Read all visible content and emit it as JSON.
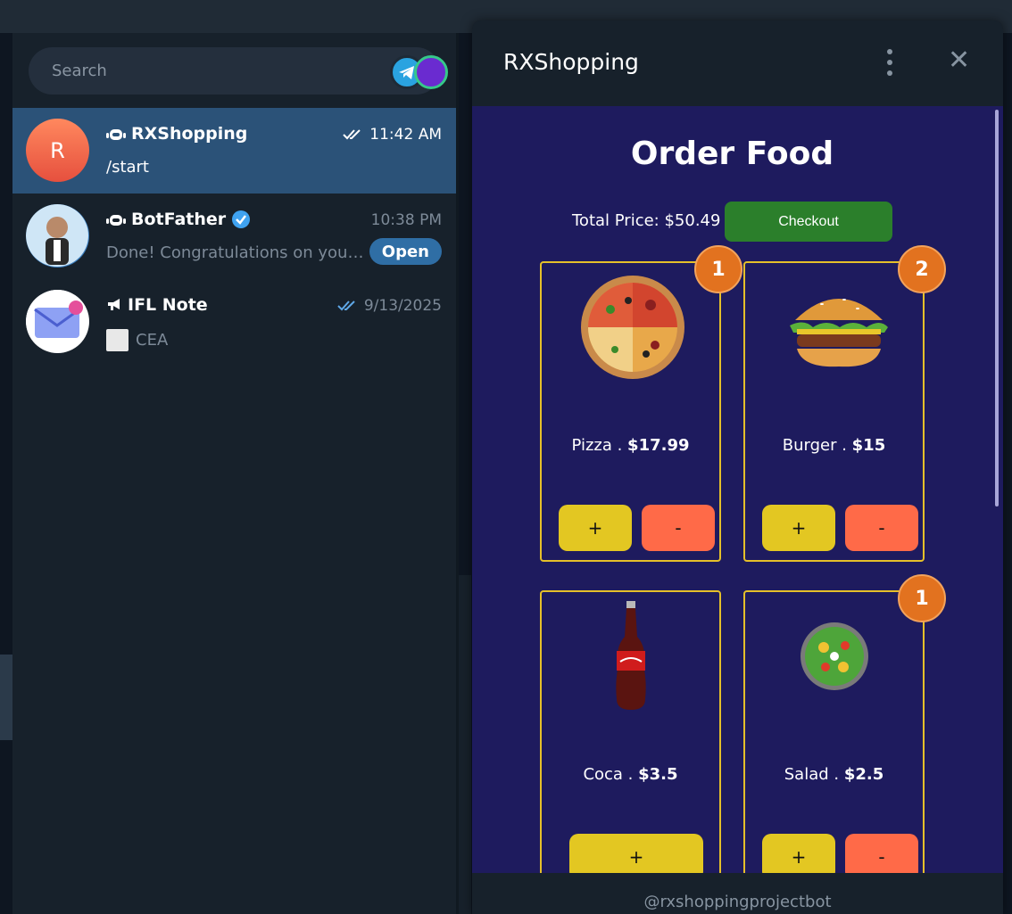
{
  "search": {
    "placeholder": "Search"
  },
  "chats": [
    {
      "name": "RXShopping",
      "time": "11:42 AM",
      "message": "/start",
      "avatar_letter": "R"
    },
    {
      "name": "BotFather",
      "time": "10:38 PM",
      "message": "Done! Congratulations on your new bot. You will find it at",
      "action": "Open"
    },
    {
      "name": "IFL Note",
      "time": "9/13/2025",
      "message": "CEA"
    }
  ],
  "panel": {
    "title": "RXShopping",
    "footer": "@rxshoppingprojectbot"
  },
  "webapp": {
    "title": "Order Food",
    "total": "Total Price: $50.49",
    "checkout": "Checkout",
    "items": [
      {
        "name": "Pizza . ",
        "price": "$17.99",
        "count": "1",
        "plus": "+",
        "minus": "-"
      },
      {
        "name": "Burger . ",
        "price": "$15",
        "count": "2",
        "plus": "+",
        "minus": "-"
      },
      {
        "name": "Coca . ",
        "price": "$3.5",
        "count": "",
        "plus": "+",
        "minus": ""
      },
      {
        "name": "Salad . ",
        "price": "$2.5",
        "count": "1",
        "plus": "+",
        "minus": "-"
      }
    ]
  },
  "colors": {
    "active_chat": "#2b5278",
    "webview_bg": "#1e1b5e",
    "card_border": "#e5c02a",
    "checkout": "#2b7f2b",
    "plus": "#e3c722",
    "minus": "#ff6a48",
    "badge": "#e2721f"
  }
}
